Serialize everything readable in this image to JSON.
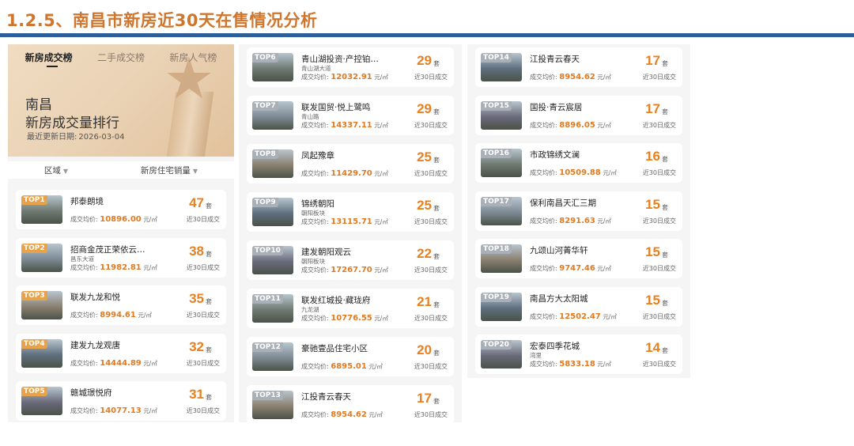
{
  "slide": {
    "title": "1.2.5、南昌市新房近30天在售情况分析"
  },
  "banner": {
    "tabs": [
      "新房成交榜",
      "二手成交榜",
      "新房人气榜"
    ],
    "city": "南昌",
    "heading": "新房成交量排行",
    "date_label": "最近更新日期:",
    "date_value": "2026-03-04"
  },
  "filters": {
    "region": "区域",
    "sort": "新房住宅销量"
  },
  "labels": {
    "price_prefix": "成交均价:",
    "unit": "元/㎡",
    "count_unit": "套",
    "period": "近30日成交"
  },
  "colors": {
    "accent": "#e8801f",
    "title": "#d0752c",
    "bar": "#2c5f9a",
    "rank_top": "#e8a24a",
    "rank_rest": "#a9b0b8"
  },
  "items": [
    {
      "rank": "TOP1",
      "name": "邦泰朗境",
      "sub": "",
      "price": "10896.00",
      "count": "47"
    },
    {
      "rank": "TOP2",
      "name": "招商金茂正荣依云…",
      "sub": "昌东大道",
      "price": "11982.81",
      "count": "38"
    },
    {
      "rank": "TOP3",
      "name": "联发九龙和悦",
      "sub": "",
      "price": "8994.61",
      "count": "35"
    },
    {
      "rank": "TOP4",
      "name": "建发九龙观唐",
      "sub": "",
      "price": "14444.89",
      "count": "32"
    },
    {
      "rank": "TOP5",
      "name": "赣城璟悦府",
      "sub": "",
      "price": "14077.13",
      "count": "31"
    },
    {
      "rank": "TOP6",
      "name": "青山湖投资·产控铂…",
      "sub": "青山湖大道",
      "price": "12032.91",
      "count": "29"
    },
    {
      "rank": "TOP7",
      "name": "联发国贸·悦上鹭鸣",
      "sub": "青山路",
      "price": "14337.11",
      "count": "29"
    },
    {
      "rank": "TOP8",
      "name": "凤起豫章",
      "sub": "",
      "price": "11429.70",
      "count": "25"
    },
    {
      "rank": "TOP9",
      "name": "锦绣朝阳",
      "sub": "朝阳板块",
      "price": "13115.71",
      "count": "25"
    },
    {
      "rank": "TOP10",
      "name": "建发朝阳观云",
      "sub": "朝阳板块",
      "price": "17267.70",
      "count": "22"
    },
    {
      "rank": "TOP11",
      "name": "联发红城投·藏珑府",
      "sub": "九龙湖",
      "price": "10776.55",
      "count": "21"
    },
    {
      "rank": "TOP12",
      "name": "豪驰壹品住宅小区",
      "sub": "",
      "price": "6895.01",
      "count": "20"
    },
    {
      "rank": "TOP13",
      "name": "江投青云春天",
      "sub": "",
      "price": "8954.62",
      "count": "17"
    },
    {
      "rank": "TOP14",
      "name": "江投青云春天",
      "sub": "",
      "price": "8954.62",
      "count": "17"
    },
    {
      "rank": "TOP15",
      "name": "国投·青云宸居",
      "sub": "",
      "price": "8896.05",
      "count": "17"
    },
    {
      "rank": "TOP16",
      "name": "市政锦绣文澜",
      "sub": "",
      "price": "10509.88",
      "count": "16"
    },
    {
      "rank": "TOP17",
      "name": "保利南昌天汇三期",
      "sub": "",
      "price": "8291.63",
      "count": "15"
    },
    {
      "rank": "TOP18",
      "name": "九颂山河菁华轩",
      "sub": "",
      "price": "9747.46",
      "count": "15"
    },
    {
      "rank": "TOP19",
      "name": "南昌方大太阳城",
      "sub": "",
      "price": "12502.47",
      "count": "15"
    },
    {
      "rank": "TOP20",
      "name": "宏泰四季花城",
      "sub": "湾里",
      "price": "5833.18",
      "count": "14"
    }
  ]
}
